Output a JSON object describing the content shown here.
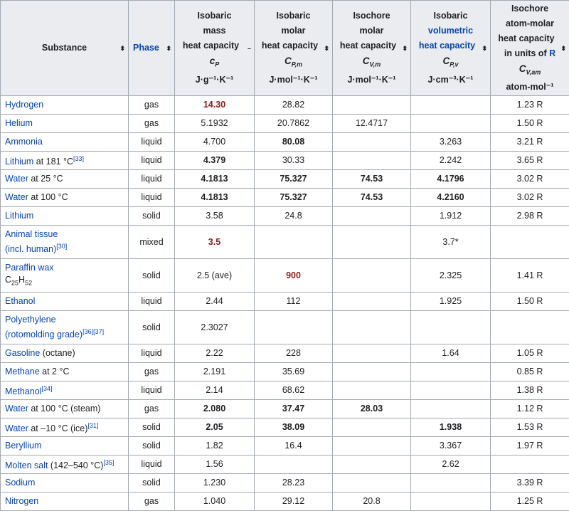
{
  "header": {
    "substance": "Substance",
    "phase": "Phase",
    "cp": {
      "l1": "Isobaric",
      "l2": "mass",
      "l3": "heat capacity",
      "sym": "c",
      "sub": "P",
      "unit": "J·g⁻¹·K⁻¹"
    },
    "cpm": {
      "l1": "Isobaric",
      "l2": "molar",
      "l3": "heat capacity",
      "sym": "C",
      "sub": "P,m",
      "unit": "J·mol⁻¹·K⁻¹"
    },
    "cvm": {
      "l1": "Isochore",
      "l2": "molar",
      "l3": "heat capacity",
      "sym": "C",
      "sub": "V,m",
      "unit": "J·mol⁻¹·K⁻¹"
    },
    "cpv": {
      "l1": "Isobaric",
      "l2": "volumetric",
      "l3": "heat capacity",
      "sym": "C",
      "sub": "P,v",
      "unit": "J·cm⁻³·K⁻¹"
    },
    "cvam": {
      "l1": "Isochore",
      "l2": "atom-molar",
      "l3": "heat capacity",
      "l4a": "in units of ",
      "l4b": "R",
      "sym": "C",
      "sub": "V,am",
      "unit": "atom-mol⁻¹"
    },
    "sort_glyph": "⬍",
    "sort_active_glyph": "–"
  },
  "rows": [
    {
      "name": "Hydrogen",
      "phase": "gas",
      "cp": "14.30",
      "cp_style": "red",
      "cpm": "28.82",
      "cvm": "",
      "cpv": "",
      "cvam": "1.23 R"
    },
    {
      "name": "Helium",
      "phase": "gas",
      "cp": "5.1932",
      "cpm": "20.7862",
      "cvm": "12.4717",
      "cpv": "",
      "cvam": "1.50 R"
    },
    {
      "name": "Ammonia",
      "phase": "liquid",
      "cp": "4.700",
      "cpm": "80.08",
      "cpm_style": "bold",
      "cvm": "",
      "cpv": "3.263",
      "cvam": "3.21 R"
    },
    {
      "name": "Lithium",
      "name_suffix": " at 181 °C",
      "ref": "[33]",
      "phase": "liquid",
      "cp": "4.379",
      "cp_style": "bold",
      "cpm": "30.33",
      "cvm": "",
      "cpv": "2.242",
      "cvam": "3.65 R"
    },
    {
      "name": "Water",
      "name_suffix": " at 25 °C",
      "phase": "liquid",
      "cp": "4.1813",
      "cp_style": "bold",
      "cpm": "75.327",
      "cpm_style": "bold",
      "cvm": "74.53",
      "cvm_style": "bold",
      "cpv": "4.1796",
      "cpv_style": "bold",
      "cvam": "3.02 R"
    },
    {
      "name": "Water",
      "name_suffix": " at 100 °C",
      "phase": "liquid",
      "cp": "4.1813",
      "cp_style": "bold",
      "cpm": "75.327",
      "cpm_style": "bold",
      "cvm": "74.53",
      "cvm_style": "bold",
      "cpv": "4.2160",
      "cpv_style": "bold",
      "cvam": "3.02 R"
    },
    {
      "name": "Lithium",
      "phase": "solid",
      "cp": "3.58",
      "cpm": "24.8",
      "cvm": "",
      "cpv": "1.912",
      "cvam": "2.98 R"
    },
    {
      "name": "Animal tissue",
      "line2": "(incl. human)",
      "ref": "[30]",
      "phase": "mixed",
      "cp": "3.5",
      "cp_style": "red",
      "cpm": "",
      "cvm": "",
      "cpv": "3.7*",
      "cvam": "",
      "tall": true
    },
    {
      "name": "Paraffin wax",
      "line2_formula": true,
      "phase": "solid",
      "cp": "2.5 (ave)",
      "cpm": "900",
      "cpm_style": "red",
      "cvm": "",
      "cpv": "2.325",
      "cvam": "1.41 R",
      "tall": true
    },
    {
      "name": "Ethanol",
      "phase": "liquid",
      "cp": "2.44",
      "cpm": "112",
      "cvm": "",
      "cpv": "1.925",
      "cvam": "1.50 R"
    },
    {
      "name": "Polyethylene",
      "line2": "(rotomolding grade)",
      "ref": "[36][37]",
      "phase": "solid",
      "cp": "2.3027",
      "cpm": "",
      "cvm": "",
      "cpv": "",
      "cvam": "",
      "tall": true
    },
    {
      "name": "Gasoline",
      "name_suffix": " (octane)",
      "phase": "liquid",
      "cp": "2.22",
      "cpm": "228",
      "cvm": "",
      "cpv": "1.64",
      "cvam": "1.05 R"
    },
    {
      "name": "Methane",
      "name_suffix": " at 2 °C",
      "phase": "gas",
      "cp": "2.191",
      "cpm": "35.69",
      "cvm": "",
      "cpv": "",
      "cvam": "0.85 R"
    },
    {
      "name": "Methanol",
      "ref": "[34]",
      "phase": "liquid",
      "cp": "2.14",
      "cpm": "68.62",
      "cvm": "",
      "cpv": "",
      "cvam": "1.38 R"
    },
    {
      "name": "Water",
      "name_suffix": " at 100 °C (steam)",
      "phase": "gas",
      "cp": "2.080",
      "cp_style": "bold",
      "cpm": "37.47",
      "cpm_style": "bold",
      "cvm": "28.03",
      "cvm_style": "bold",
      "cpv": "",
      "cvam": "1.12 R"
    },
    {
      "name": "Water",
      "name_suffix": " at –10 °C (ice)",
      "ref": "[31]",
      "phase": "solid",
      "cp": "2.05",
      "cp_style": "bold",
      "cpm": "38.09",
      "cpm_style": "bold",
      "cvm": "",
      "cpv": "1.938",
      "cpv_style": "bold",
      "cvam": "1.53 R"
    },
    {
      "name": "Beryllium",
      "phase": "solid",
      "cp": "1.82",
      "cpm": "16.4",
      "cvm": "",
      "cpv": "3.367",
      "cvam": "1.97 R"
    },
    {
      "name": "Molten salt",
      "name_suffix": " (142–540 °C)",
      "ref": "[35]",
      "phase": "liquid",
      "cp": "1.56",
      "cpm": "",
      "cvm": "",
      "cpv": "2.62",
      "cvam": ""
    },
    {
      "name": "Sodium",
      "phase": "solid",
      "cp": "1.230",
      "cpm": "28.23",
      "cvm": "",
      "cpv": "",
      "cvam": "3.39 R"
    },
    {
      "name": "Nitrogen",
      "phase": "gas",
      "cp": "1.040",
      "cpm": "29.12",
      "cvm": "20.8",
      "cpv": "",
      "cvam": "1.25 R"
    }
  ],
  "formula": {
    "c": "C",
    "c_n": "25",
    "h": "H",
    "h_n": "52"
  }
}
